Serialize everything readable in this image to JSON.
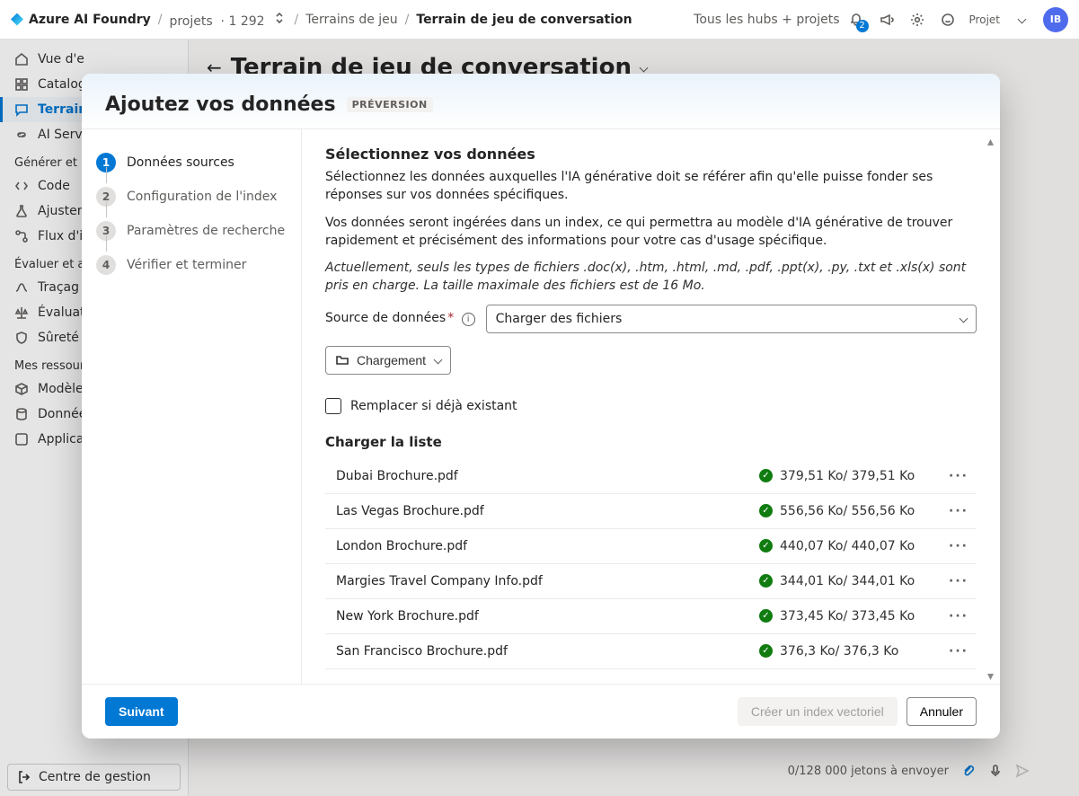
{
  "header": {
    "brand": "Azure AI Foundry",
    "breadcrumbs": {
      "projects_label": "projets",
      "projects_count": "1 292",
      "playgrounds": "Terrains de jeu",
      "current": "Terrain de jeu de conversation"
    },
    "all_hubs": "Tous les hubs + projets",
    "notifications_badge": "2",
    "project_label": "Projet",
    "avatar_initials": "IB"
  },
  "page": {
    "title": "Terrain de jeu de conversation"
  },
  "sidebar": {
    "items_top": [
      "Vue d'e",
      "Catalog",
      "Terrain",
      "AI Servi"
    ],
    "group1_title": "Générer et p",
    "items_g1": [
      "Code",
      "Ajuster",
      "Flux d'i"
    ],
    "group2_title": "Évaluer et an",
    "items_g2": [
      "Traçag",
      "Évaluat",
      "Sûreté"
    ],
    "group3_title": "Mes ressourc",
    "items_g3": [
      "Modèle",
      "Donnée",
      "Applica"
    ],
    "bottom": "Centre de gestion"
  },
  "modal": {
    "title": "Ajoutez vos données",
    "preview": "PRÉVERSION",
    "steps": [
      "Données sources",
      "Configuration de l'index",
      "Paramètres de recherche",
      "Vérifier et terminer"
    ],
    "content": {
      "heading": "Sélectionnez vos données",
      "p1": "Sélectionnez les données auxquelles l'IA générative doit se référer afin qu'elle puisse fonder ses réponses sur vos données spécifiques.",
      "p2": "Vos données seront ingérées dans un index, ce qui permettra au modèle d'IA générative de trouver rapidement et précisément des informations pour votre cas d'usage spécifique.",
      "hint": "Actuellement, seuls les types de fichiers .doc(x), .htm, .html, .md, .pdf, .ppt(x), .py, .txt et .xls(x) sont pris en charge. La taille maximale des fichiers est de 16 Mo.",
      "datasource_label": "Source de données",
      "datasource_value": "Charger des fichiers",
      "upload_btn": "Chargement",
      "replace_label": "Remplacer si déjà existant",
      "list_title": "Charger la liste",
      "files": [
        {
          "name": "Dubai Brochure.pdf",
          "size": "379,51 Ko/ 379,51 Ko"
        },
        {
          "name": "Las Vegas Brochure.pdf",
          "size": "556,56 Ko/ 556,56 Ko"
        },
        {
          "name": "London Brochure.pdf",
          "size": "440,07 Ko/ 440,07 Ko"
        },
        {
          "name": "Margies Travel Company Info.pdf",
          "size": "344,01 Ko/ 344,01 Ko"
        },
        {
          "name": "New York Brochure.pdf",
          "size": "373,45 Ko/ 373,45 Ko"
        },
        {
          "name": "San Francisco Brochure.pdf",
          "size": "376,3 Ko/ 376,3 Ko"
        }
      ]
    },
    "footer": {
      "next": "Suivant",
      "create_index": "Créer un index vectoriel",
      "cancel": "Annuler"
    }
  },
  "chat_footer": {
    "tokens": "0/128 000 jetons à envoyer"
  }
}
